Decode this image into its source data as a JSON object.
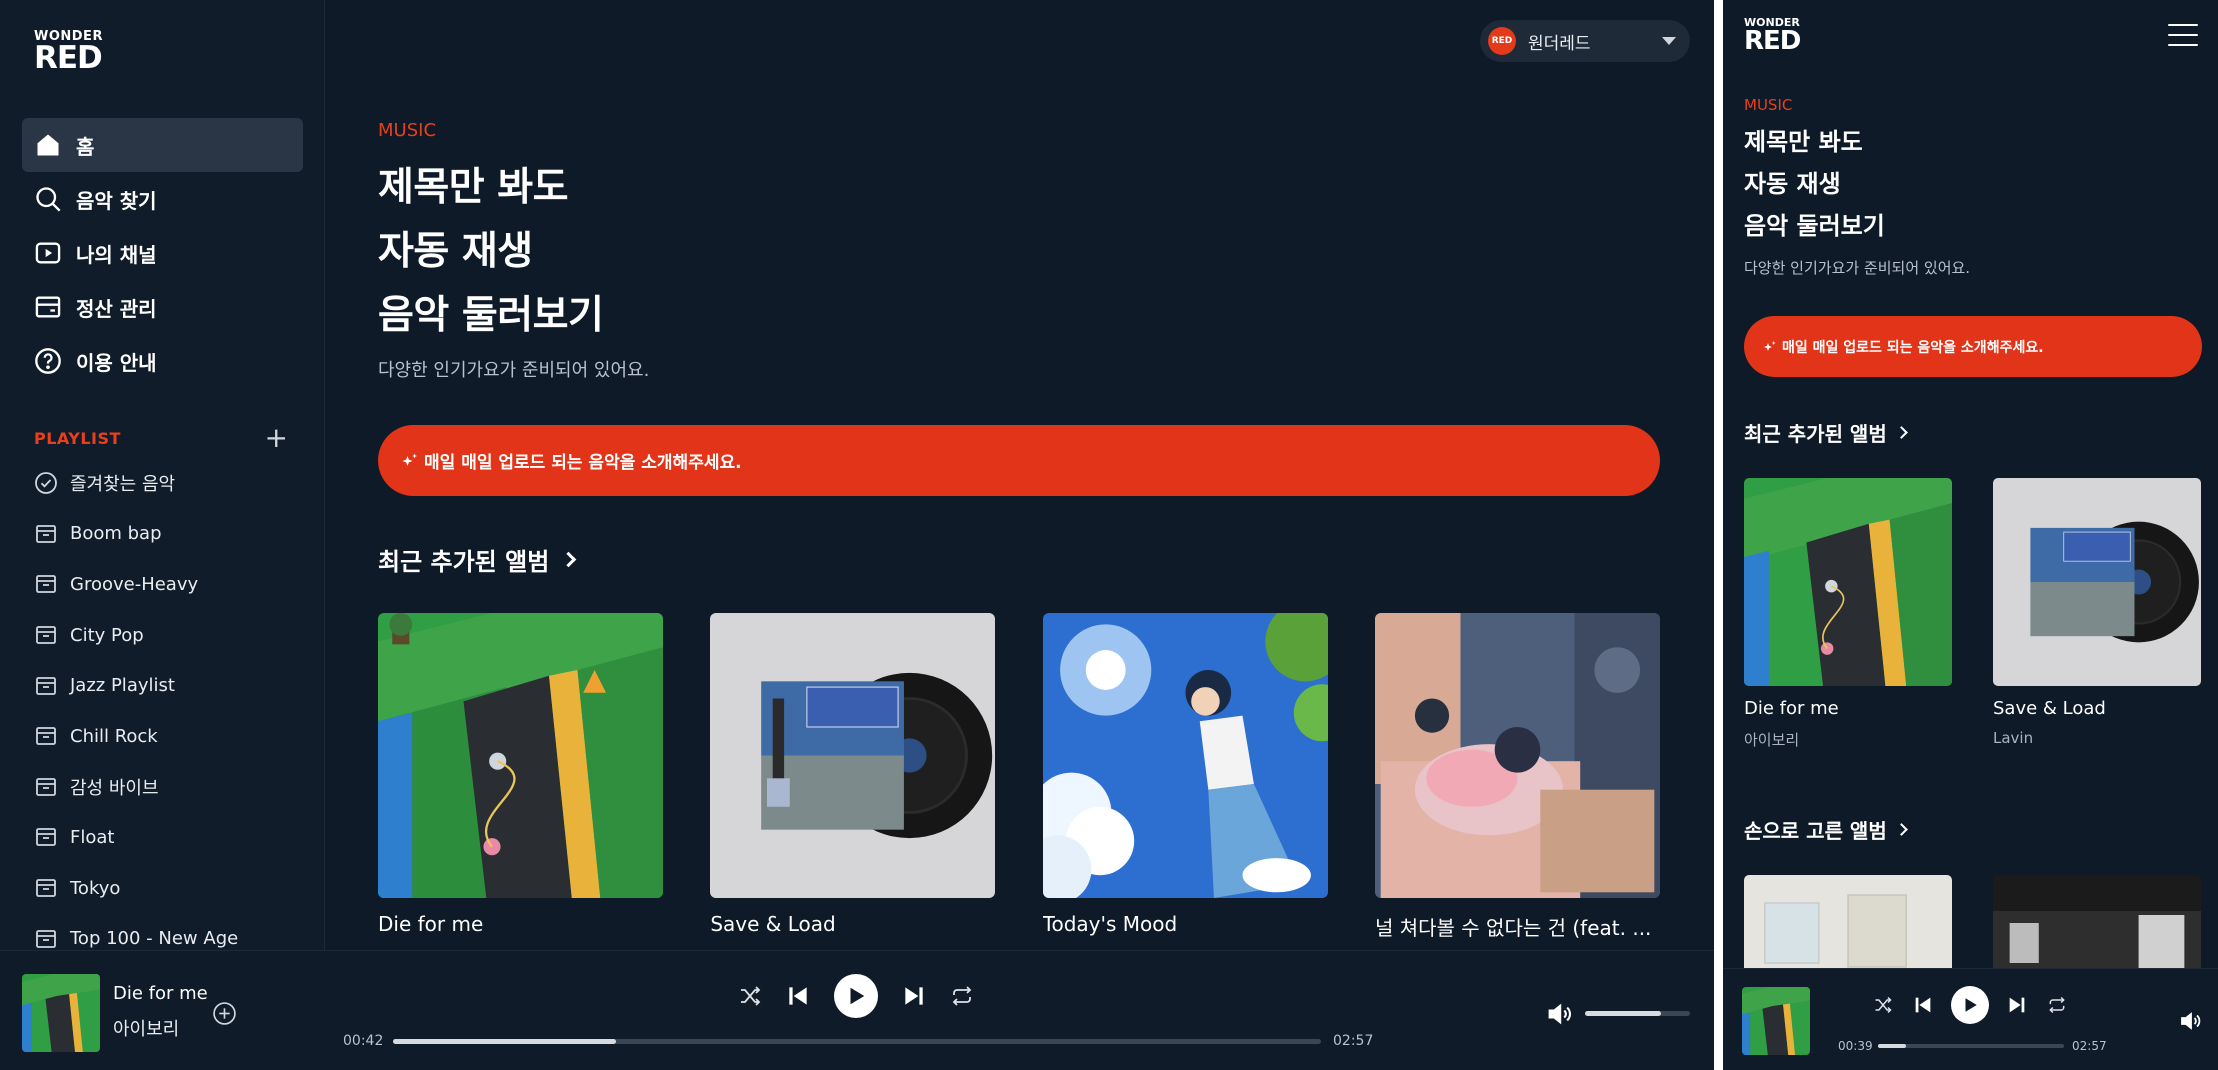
{
  "brand": {
    "line1": "WONDER",
    "line2": "RED"
  },
  "sidebar": {
    "nav": [
      {
        "label": "홈",
        "icon": "home-icon"
      },
      {
        "label": "음악 찾기",
        "icon": "search-icon"
      },
      {
        "label": "나의 채널",
        "icon": "play-square-icon"
      },
      {
        "label": "정산 관리",
        "icon": "wallet-icon"
      },
      {
        "label": "이용 안내",
        "icon": "help-icon"
      }
    ],
    "playlist_title": "PLAYLIST",
    "playlists": [
      "즐겨찾는 음악",
      "Boom bap",
      "Groove-Heavy",
      "City Pop",
      "Jazz Playlist",
      "Chill Rock",
      "감성 바이브",
      "Float",
      "Tokyo",
      "Top 100 - New Age"
    ]
  },
  "user": {
    "avatar_text": "RED",
    "name": "원더레드"
  },
  "main": {
    "kicker": "MUSIC",
    "hero": [
      "제목만 봐도",
      "자동 재생",
      "음악 둘러보기"
    ],
    "subtitle": "다양한 인기가요가 준비되어 있어요.",
    "banner": "매일 매일 업로드 되는 음악을 소개해주세요.",
    "recent_title": "최근 추가된 앨범",
    "albums": [
      {
        "title": "Die for me",
        "artist": "아이보리"
      },
      {
        "title": "Save & Load",
        "artist": "Lavin"
      },
      {
        "title": "Today's Mood"
      },
      {
        "title": "널 쳐다볼 수 없다는 건 (feat. ..."
      }
    ],
    "curated_title": "손으로 고른 앨범"
  },
  "player": {
    "title": "Die for me",
    "artist": "아이보리",
    "current": "00:42",
    "total": "02:57",
    "progress": 0.24,
    "volume": 0.72
  },
  "mobile_player": {
    "current": "00:39",
    "total": "02:57",
    "progress": 0.15
  },
  "colors": {
    "accent": "#e23418",
    "background": "#0e1a28"
  }
}
